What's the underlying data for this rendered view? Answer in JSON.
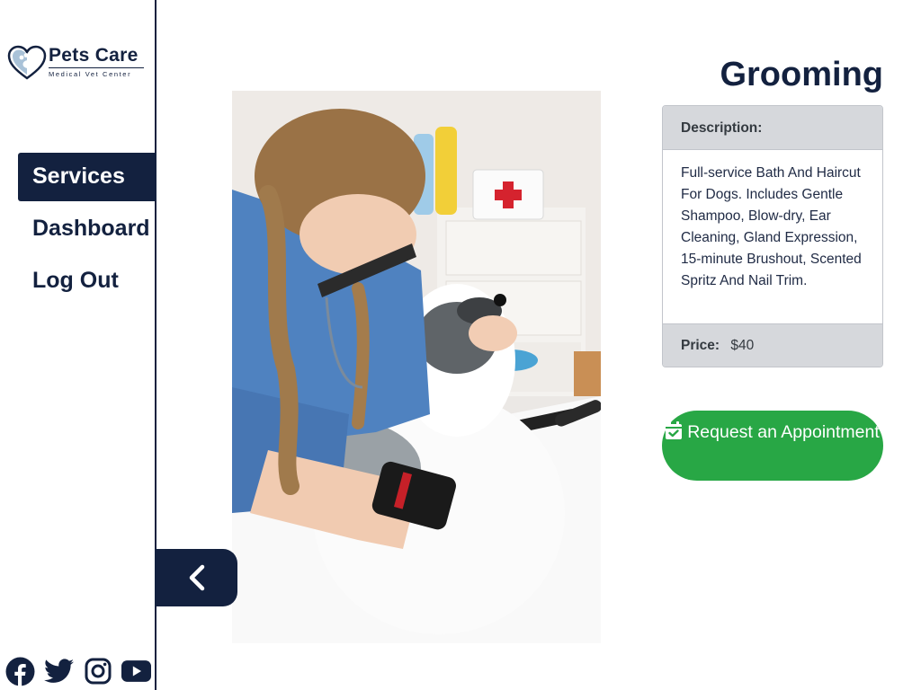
{
  "brand": {
    "name": "Pets Care",
    "tagline": "Medical Vet Center"
  },
  "nav": {
    "items": [
      {
        "label": "Services",
        "active": true
      },
      {
        "label": "Dashboard",
        "active": false
      },
      {
        "label": "Log Out",
        "active": false
      }
    ]
  },
  "social": {
    "icons": [
      "facebook-icon",
      "twitter-icon",
      "instagram-icon",
      "youtube-icon"
    ]
  },
  "service": {
    "title": "Grooming",
    "description_label": "Description:",
    "description": "Full-service Bath And Haircut For Dogs. Includes Gentle Shampoo, Blow-dry, Ear Cleaning, Gland Expression, 15-minute Brushout, Scented Spritz And Nail Trim.",
    "price_label": "Price:",
    "price": "$40"
  },
  "actions": {
    "appointment_label": "Request an Appointment",
    "back_icon": "chevron-left-icon"
  },
  "colors": {
    "navy": "#13213f",
    "accent_green": "#28a745",
    "card_header": "#d6d8dc"
  }
}
